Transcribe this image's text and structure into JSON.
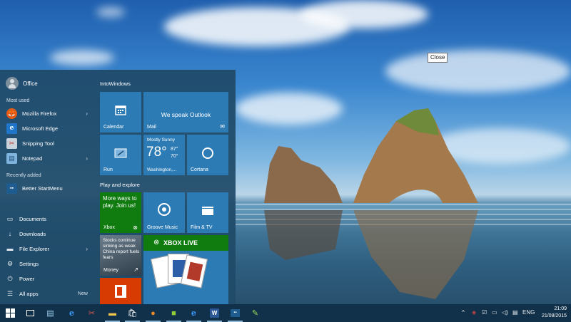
{
  "tooltip": "Close",
  "start_menu": {
    "user": "Office",
    "most_used_label": "Most used",
    "most_used": [
      {
        "label": "Mozilla Firefox",
        "icon": "firefox-icon",
        "has_submenu": true
      },
      {
        "label": "Microsoft Edge",
        "icon": "edge-icon",
        "has_submenu": false
      },
      {
        "label": "Snipping Tool",
        "icon": "snipping-tool-icon",
        "has_submenu": false
      },
      {
        "label": "Notepad",
        "icon": "notepad-icon",
        "has_submenu": true
      }
    ],
    "recently_added_label": "Recently added",
    "recently_added": [
      {
        "label": "Better StartMenu",
        "icon": "better-startmenu-icon"
      }
    ],
    "system_items": [
      {
        "label": "Documents",
        "icon": "documents-icon"
      },
      {
        "label": "Downloads",
        "icon": "downloads-icon"
      },
      {
        "label": "File Explorer",
        "icon": "file-explorer-icon",
        "has_submenu": true
      },
      {
        "label": "Settings",
        "icon": "settings-icon"
      },
      {
        "label": "Power",
        "icon": "power-icon"
      },
      {
        "label": "All apps",
        "icon": "all-apps-icon",
        "badge": "New"
      }
    ],
    "groups": [
      {
        "title": "IntoWindows"
      },
      {
        "title": "Play and explore"
      }
    ],
    "tiles": {
      "calendar": {
        "label": "Calendar"
      },
      "mail": {
        "label": "Mail",
        "headline": "We speak Outlook"
      },
      "run": {
        "label": "Run"
      },
      "weather": {
        "condition": "Mostly Sunny",
        "temp": "78°",
        "high": "87°",
        "low": "70°",
        "location": "Washington,..."
      },
      "cortana": {
        "label": "Cortana"
      },
      "xbox": {
        "label": "Xbox",
        "promo": "More ways to play. Join us!"
      },
      "groove": {
        "label": "Groove Music"
      },
      "film": {
        "label": "Film & TV"
      },
      "money": {
        "label": "Money",
        "headline": "Stocks continue sinking as weak China report fuels fears"
      },
      "xbox_live": {
        "label": "XBOX LIVE"
      }
    }
  },
  "taskbar": {
    "language": "ENG",
    "time": "21:09",
    "date": "21/08/2015"
  },
  "colors": {
    "tile_blue": "#2d7bb4",
    "tile_green": "#107c10",
    "tile_red": "#d83b01",
    "taskbar": "#113049"
  }
}
